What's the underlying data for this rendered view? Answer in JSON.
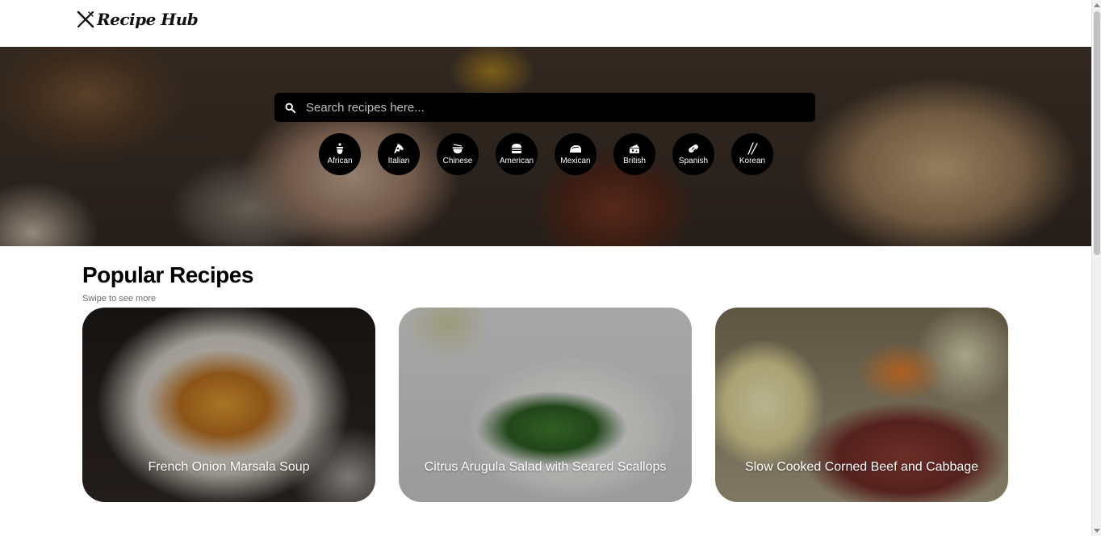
{
  "header": {
    "logo_text": "Recipe Hub"
  },
  "search": {
    "placeholder": "Search recipes here..."
  },
  "categories": [
    {
      "label": "African",
      "icon": "pot-icon"
    },
    {
      "label": "Italian",
      "icon": "pizza-icon"
    },
    {
      "label": "Chinese",
      "icon": "noodle-bowl-icon"
    },
    {
      "label": "American",
      "icon": "burger-icon"
    },
    {
      "label": "Mexican",
      "icon": "taco-icon"
    },
    {
      "label": "British",
      "icon": "cheese-icon"
    },
    {
      "label": "Spanish",
      "icon": "sausage-icon"
    },
    {
      "label": "Korean",
      "icon": "chopsticks-icon"
    }
  ],
  "popular": {
    "title": "Popular Recipes",
    "subtitle": "Swipe to see more",
    "cards": [
      {
        "title": "French Onion Marsala Soup"
      },
      {
        "title": "Citrus Arugula Salad with Seared Scallops"
      },
      {
        "title": "Slow Cooked Corned Beef and Cabbage"
      }
    ]
  }
}
